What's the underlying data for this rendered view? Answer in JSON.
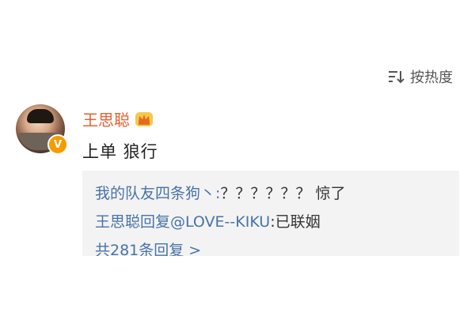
{
  "sort": {
    "label": "按热度",
    "icon": "sort-icon"
  },
  "comment": {
    "username": "王思聪",
    "badge_text": "V",
    "text": "上单 狼行",
    "replies": [
      {
        "prefix": "我的队友四条狗丶:",
        "content": "？？？？？？ 惊了"
      },
      {
        "prefix": "王思聪回复",
        "mention": "@LOVE--KIKU",
        "content": ":已联姻"
      }
    ],
    "more_replies": "共281条回复 >"
  },
  "colors": {
    "username": "#e9602f",
    "reply_user": "#4873a8",
    "reply_bg": "#f3f3f3",
    "badge": "#f59b00"
  }
}
